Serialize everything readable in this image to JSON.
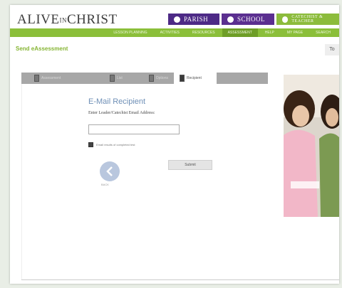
{
  "header": {
    "logo_left": "ALIVE",
    "logo_mid": "IN",
    "logo_right": "CHRIST",
    "buttons": {
      "parish": "PARISH",
      "school": "SCHOOL",
      "catechist": "CATECHIST & TEACHER"
    }
  },
  "nav": {
    "items": [
      "LESSON PLANNING",
      "ACTIVITIES",
      "RESOURCES",
      "ASSESSMENT",
      "HELP",
      "MY PAGE",
      "SEARCH"
    ],
    "active_index": 3
  },
  "page": {
    "title": "Send eAssessment",
    "top_right": "To"
  },
  "tabs": [
    {
      "label": "Assessment"
    },
    {
      "label": "List"
    },
    {
      "label": "Options"
    },
    {
      "label": "Recipient"
    }
  ],
  "form": {
    "heading": "E-Mail Recipient",
    "instruction": "Enter Leader/Catechist Email Address:",
    "email_value": "",
    "checkbox_label": "Email results of completed test",
    "submit_label": "Submit",
    "back_label": "BACK"
  },
  "colors": {
    "nav_green": "#8bbf3a",
    "parish_purple": "#4d2a86",
    "heading_blue": "#6e8fb6"
  }
}
